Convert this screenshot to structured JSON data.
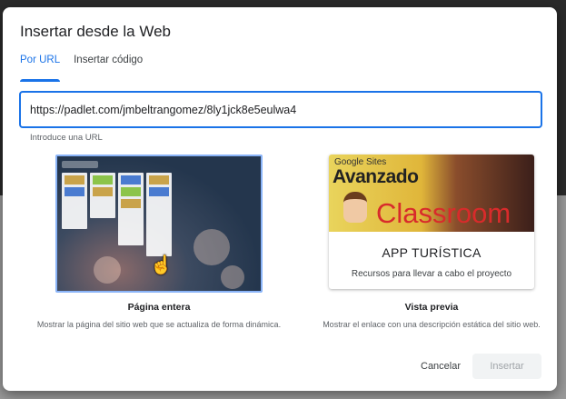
{
  "dialog": {
    "title": "Insertar desde la Web",
    "tabs": [
      {
        "label": "Por URL",
        "active": true
      },
      {
        "label": "Insertar código",
        "active": false
      }
    ],
    "url_field": {
      "value": "https://padlet.com/jmbeltrangomez/8ly1jck8e5eulwa4",
      "helper": "Introduce una URL"
    },
    "options": {
      "full_page": {
        "label": "Página entera",
        "description": "Mostrar la página del sitio web que se actualiza de forma dinámica."
      },
      "preview": {
        "label": "Vista previa",
        "description": "Mostrar el enlace con una descripción estática del sitio web.",
        "card": {
          "brand_text": "Google Sites",
          "headline": "Avanzado",
          "overlay_text": "Classroom",
          "title": "APP TURÍSTICA",
          "description": "Recursos para llevar a cabo el proyecto"
        }
      }
    },
    "buttons": {
      "cancel": "Cancelar",
      "insert": "Insertar"
    }
  },
  "colors": {
    "accent": "#1a73e8",
    "thumb_border": "#8ab4f8",
    "disabled_bg": "#f1f3f4"
  }
}
